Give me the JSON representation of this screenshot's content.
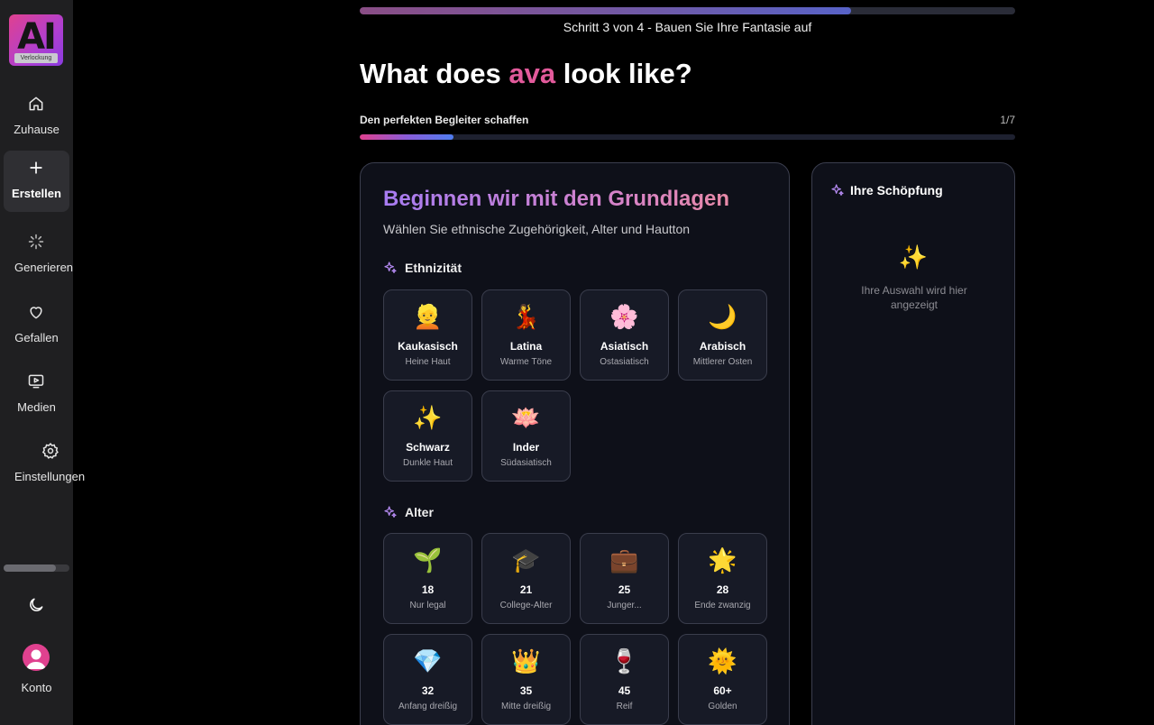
{
  "brand": {
    "logo_text": "AI",
    "logo_tag": "Verlockung"
  },
  "nav": [
    {
      "icon": "home-icon",
      "label": "Zuhause"
    },
    {
      "icon": "plus-icon",
      "label": "Erstellen",
      "active": true
    },
    {
      "icon": "loader-icon",
      "label": "Generieren"
    },
    {
      "icon": "heart-icon",
      "label": "Gefallen"
    },
    {
      "icon": "media-icon",
      "label": "Medien"
    },
    {
      "icon": "gear-icon",
      "label": "Einstellungen"
    }
  ],
  "account": {
    "label": "Konto"
  },
  "progress": {
    "step_text": "Schritt 3 von 4 - Bauen Sie Ihre Fantasie auf",
    "fraction": 0.75
  },
  "headline": {
    "before": "What does ",
    "name": "ava",
    "after": " look like?"
  },
  "substep": {
    "label": "Den perfekten Begleiter schaffen",
    "count": "1/7",
    "fraction": 0.143
  },
  "card": {
    "title": "Beginnen wir mit den Grundlagen",
    "subtitle": "Wählen Sie ethnische Zugehörigkeit, Alter und Hautton",
    "ethnicity_label": "Ethnizität",
    "ethnicities": [
      {
        "emoji": "👱",
        "title": "Kaukasisch",
        "desc": "Heine Haut"
      },
      {
        "emoji": "💃",
        "title": "Latina",
        "desc": "Warme Töne"
      },
      {
        "emoji": "🌸",
        "title": "Asiatisch",
        "desc": "Ostasiatisch"
      },
      {
        "emoji": "🌙",
        "title": "Arabisch",
        "desc": "Mittlerer Osten"
      },
      {
        "emoji": "✨",
        "title": "Schwarz",
        "desc": "Dunkle Haut"
      },
      {
        "emoji": "🪷",
        "title": "Inder",
        "desc": "Südasiatisch"
      }
    ],
    "age_label": "Alter",
    "ages": [
      {
        "emoji": "🌱",
        "title": "18",
        "desc": "Nur legal"
      },
      {
        "emoji": "🎓",
        "title": "21",
        "desc": "College-Alter"
      },
      {
        "emoji": "💼",
        "title": "25",
        "desc": "Junger..."
      },
      {
        "emoji": "🌟",
        "title": "28",
        "desc": "Ende zwanzig"
      },
      {
        "emoji": "💎",
        "title": "32",
        "desc": "Anfang dreißig"
      },
      {
        "emoji": "👑",
        "title": "35",
        "desc": "Mitte dreißig"
      },
      {
        "emoji": "🍷",
        "title": "45",
        "desc": "Reif"
      },
      {
        "emoji": "🌞",
        "title": "60+",
        "desc": "Golden"
      }
    ]
  },
  "preview": {
    "title": "Ihre Schöpfung",
    "emoji": "✨",
    "empty": "Ihre Auswahl wird hier angezeigt"
  }
}
